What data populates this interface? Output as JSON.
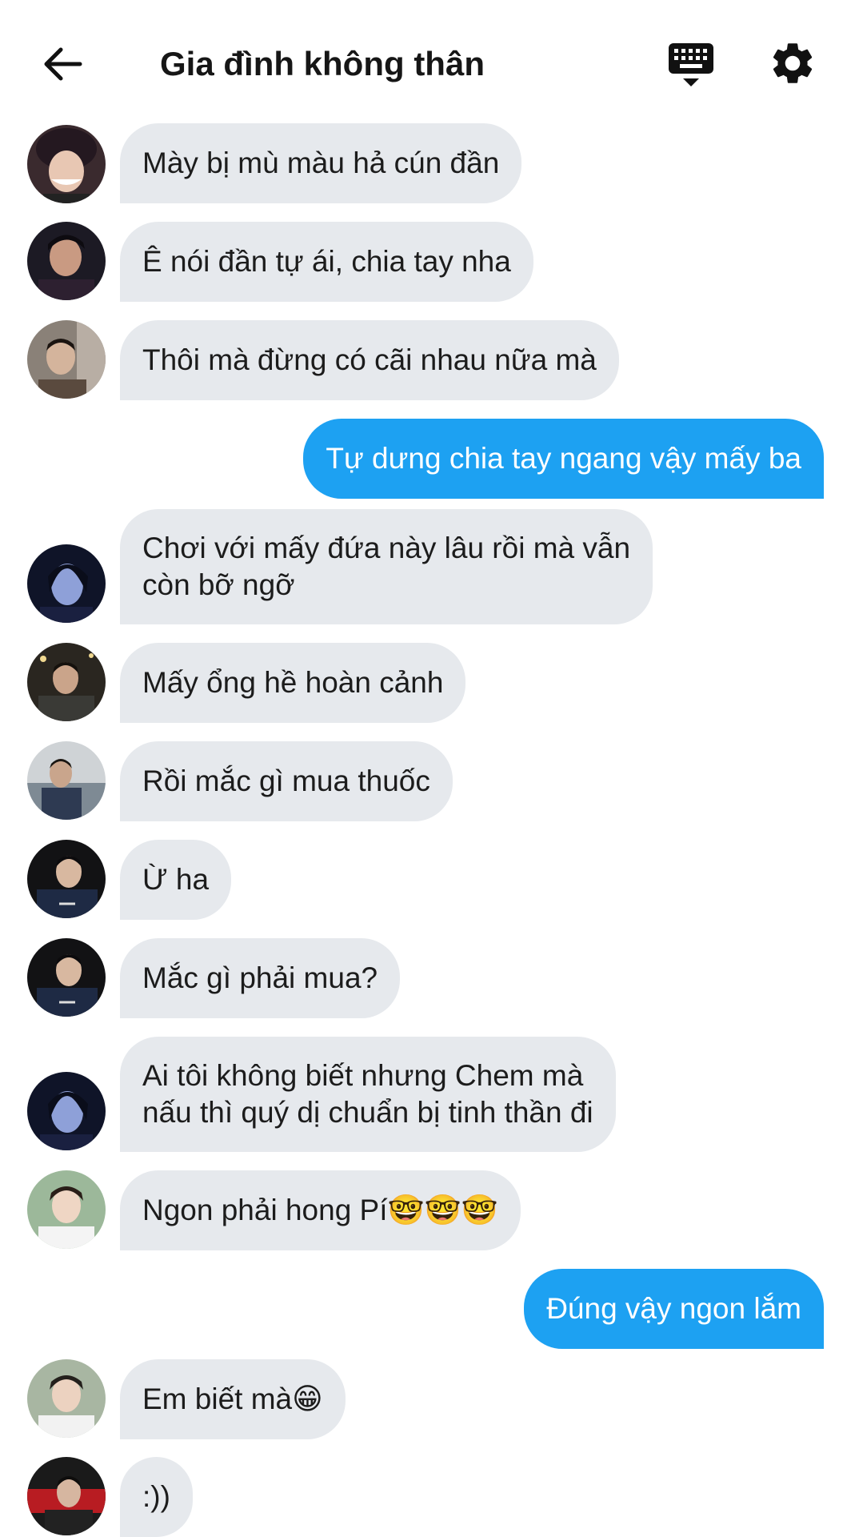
{
  "header": {
    "title": "Gia đình không thân",
    "back_icon": "arrow-left-icon",
    "keyboard_icon": "keyboard-icon",
    "settings_icon": "gear-icon"
  },
  "colors": {
    "incoming_bubble": "#e6e9ed",
    "outgoing_bubble": "#1da1f2"
  },
  "messages": [
    {
      "side": "in",
      "text": "Mày bị mù màu hả cún đần"
    },
    {
      "side": "in",
      "text": "Ê nói đần tự ái, chia tay nha"
    },
    {
      "side": "in",
      "text": "Thôi mà đừng có cãi nhau nữa mà"
    },
    {
      "side": "out",
      "text": "Tự dưng chia tay ngang vậy mấy ba"
    },
    {
      "side": "in",
      "text": "Chơi với mấy đứa này lâu rồi mà vẫn\ncòn bỡ ngỡ"
    },
    {
      "side": "in",
      "text": "Mấy ổng hề hoàn cảnh"
    },
    {
      "side": "in",
      "text": "Rồi mắc gì mua thuốc"
    },
    {
      "side": "in",
      "text": "Ừ ha"
    },
    {
      "side": "in",
      "text": "Mắc gì phải mua?"
    },
    {
      "side": "in",
      "text": "Ai tôi không biết nhưng Chem mà\nnấu thì quý dị chuẩn bị tinh thần đi"
    },
    {
      "side": "in",
      "text": "Ngon phải hong Pí🤓🤓🤓"
    },
    {
      "side": "out",
      "text": "Đúng vậy ngon lắm"
    },
    {
      "side": "in",
      "text": "Em biết mà😁"
    },
    {
      "side": "in",
      "text": ":))"
    }
  ]
}
